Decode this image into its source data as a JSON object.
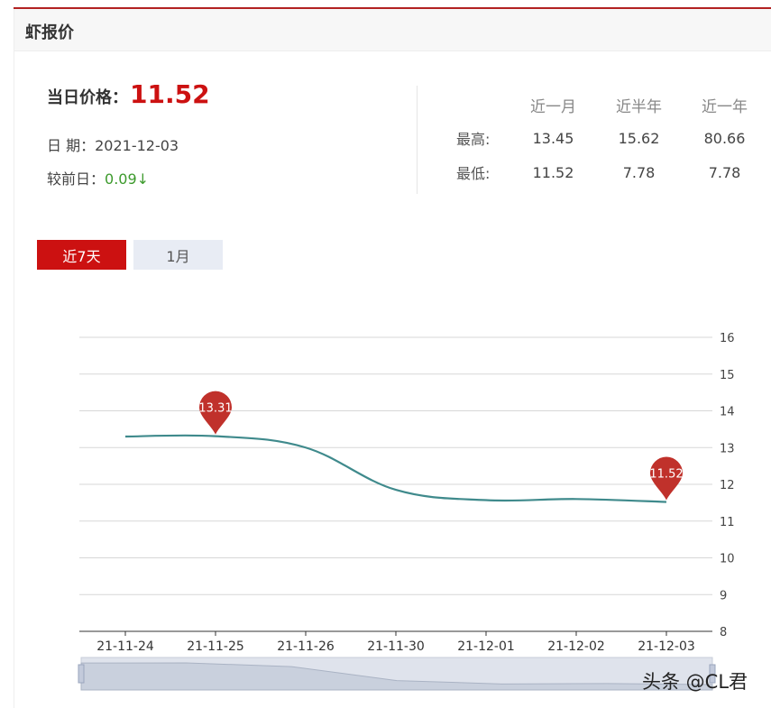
{
  "header": {
    "title": "虾报价"
  },
  "price": {
    "label": "当日价格：",
    "value": "11.52",
    "date_label": "日 期：",
    "date_value": "2021-12-03",
    "change_label": "较前日：",
    "change_value": "0.09",
    "change_arrow": "↓",
    "change_color": "#3c9a2c"
  },
  "stats": {
    "columns": [
      "近一月",
      "近半年",
      "近一年"
    ],
    "rows": [
      {
        "label": "最高:",
        "values": [
          "13.45",
          "15.62",
          "80.66"
        ]
      },
      {
        "label": "最低:",
        "values": [
          "11.52",
          "7.78",
          "7.78"
        ]
      }
    ]
  },
  "tabs": [
    {
      "label": "近7天",
      "active": true
    },
    {
      "label": "1月",
      "active": false
    }
  ],
  "colors": {
    "accent": "#cc1111",
    "line": "#3f8a8c",
    "marker": "#c0312b",
    "header_rule": "#b22222"
  },
  "chart_data": {
    "type": "line",
    "categories": [
      "21-11-24",
      "21-11-25",
      "21-11-26",
      "21-11-30",
      "21-12-01",
      "21-12-02",
      "21-12-03"
    ],
    "series": [
      {
        "values": [
          13.3,
          13.31,
          13.0,
          11.85,
          11.57,
          11.6,
          11.52
        ]
      }
    ],
    "markers": [
      {
        "category": "21-11-25",
        "value": 13.31,
        "label": "13.31"
      },
      {
        "category": "21-12-03",
        "value": 11.52,
        "label": "11.52"
      }
    ],
    "yaxis_ticks": [
      "8",
      "9",
      "10",
      "11",
      "12",
      "13",
      "14",
      "15",
      "16"
    ],
    "ylim": [
      8,
      16
    ],
    "yaxis_position": "right",
    "grid": true,
    "dataZoom": true
  },
  "watermark": {
    "text": "头条 @CL君"
  }
}
